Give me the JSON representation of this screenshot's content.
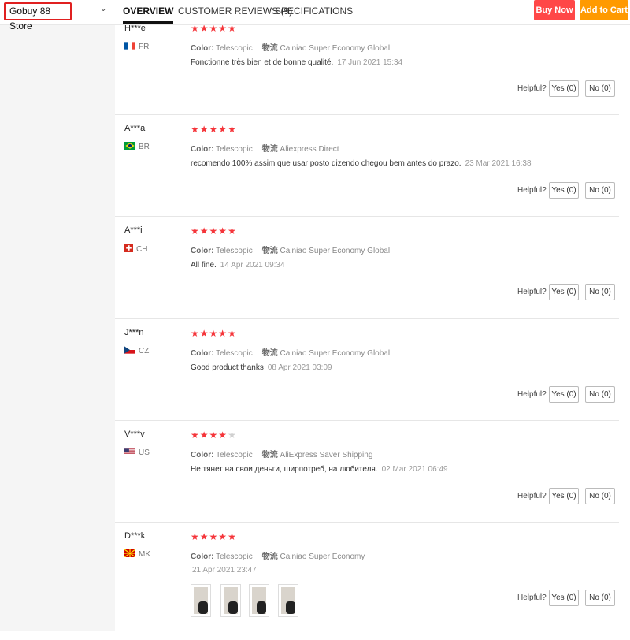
{
  "topbar": {
    "store": "Gobuy 88 Store",
    "tabs": [
      "OVERVIEW",
      "CUSTOMER REVIEWS (9)",
      "SPECIFICATIONS"
    ],
    "buy_now": "Buy Now",
    "add_to_cart": "Add to Cart"
  },
  "colors": {
    "accent_red": "#ff4747",
    "accent_orange": "#ff9a00",
    "star": "#f5353a"
  },
  "labels": {
    "color": "Color:",
    "logistics": "物流",
    "helpful": "Helpful?",
    "yes": "Yes (0)",
    "no": "No (0)"
  },
  "reviews": [
    {
      "user": "H***e",
      "country": "FR",
      "rating": 5,
      "color": "Telescopic",
      "logistics": "Cainiao Super Economy Global",
      "text": "Fonctionne très bien et de bonne qualité.",
      "date": "17 Jun 2021 15:34"
    },
    {
      "user": "A***a",
      "country": "BR",
      "rating": 5,
      "color": "Telescopic",
      "logistics": "Aliexpress Direct",
      "text": "recomendo 100% assim que usar posto dizendo chegou bem antes do prazo.",
      "date": "23 Mar 2021 16:38"
    },
    {
      "user": "A***i",
      "country": "CH",
      "rating": 5,
      "color": "Telescopic",
      "logistics": "Cainiao Super Economy Global",
      "text": "All fine.",
      "date": "14 Apr 2021 09:34"
    },
    {
      "user": "J***n",
      "country": "CZ",
      "rating": 5,
      "color": "Telescopic",
      "logistics": "Cainiao Super Economy Global",
      "text": "Good product thanks",
      "date": "08 Apr 2021 03:09"
    },
    {
      "user": "V***v",
      "country": "US",
      "rating": 4,
      "color": "Telescopic",
      "logistics": "AliExpress Saver Shipping",
      "text": "Не тянет на свои деньги, ширпотреб, на любителя.",
      "date": "02 Mar 2021 06:49"
    },
    {
      "user": "D***k",
      "country": "MK",
      "rating": 5,
      "color": "Telescopic",
      "logistics": "Cainiao Super Economy",
      "text": "",
      "date": "21 Apr 2021 23:47"
    }
  ]
}
